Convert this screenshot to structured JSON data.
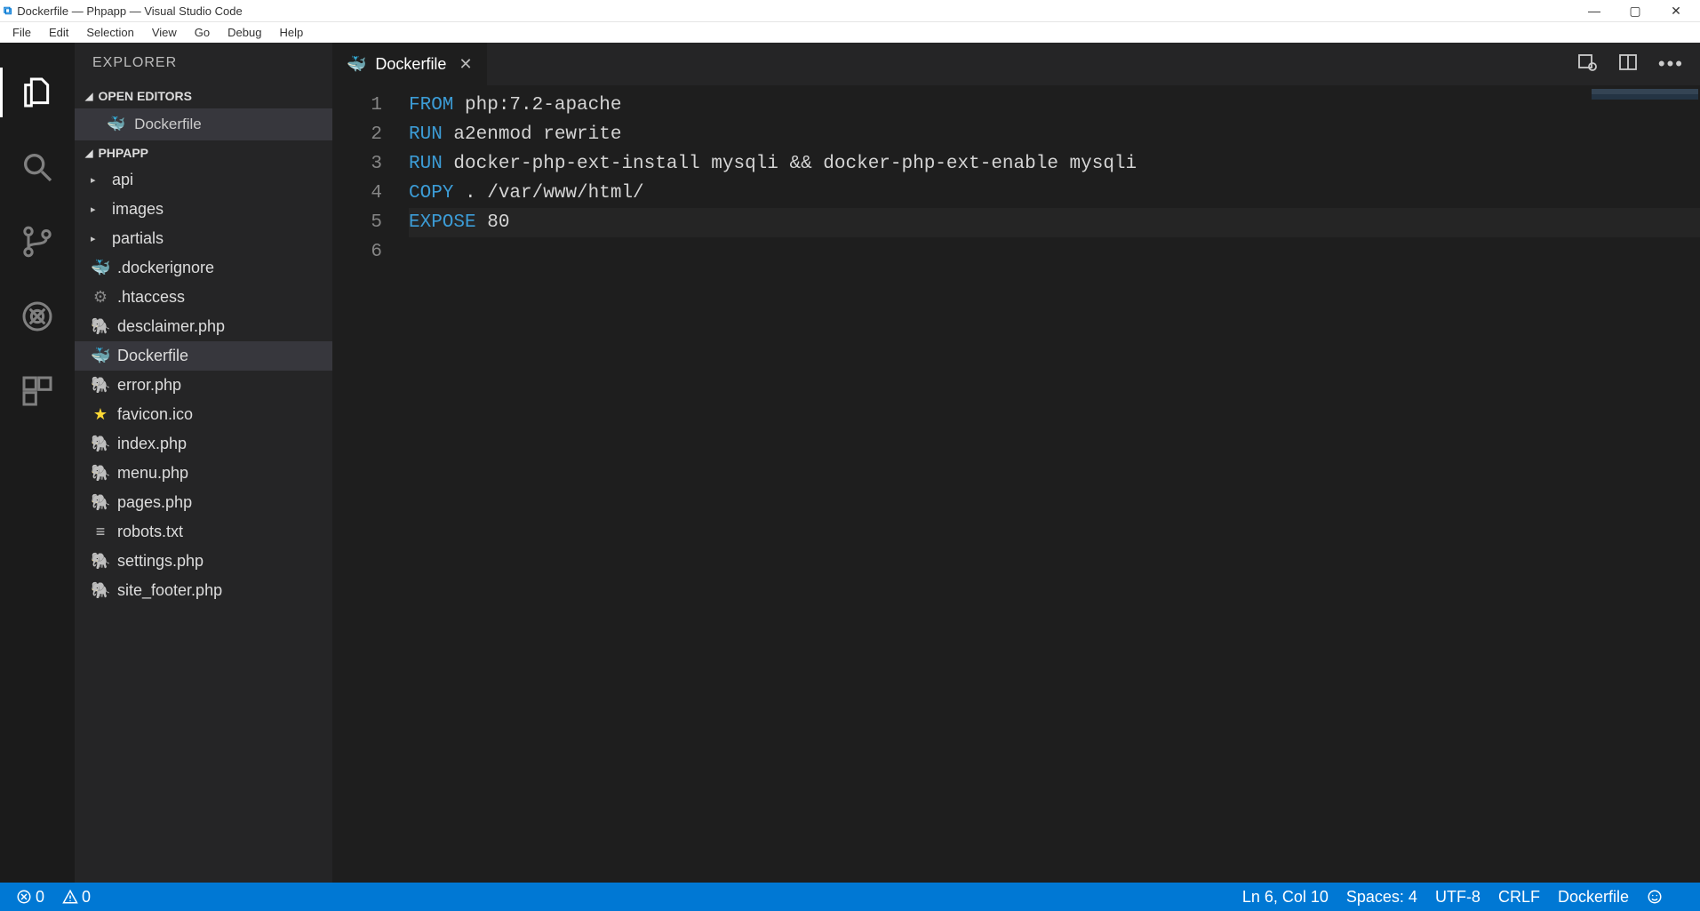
{
  "title_bar": {
    "title": "Dockerfile — Phpapp — Visual Studio Code"
  },
  "menu": {
    "items": [
      "File",
      "Edit",
      "Selection",
      "View",
      "Go",
      "Debug",
      "Help"
    ]
  },
  "sidebar": {
    "title": "EXPLORER",
    "open_editors_label": "OPEN EDITORS",
    "open_editor_file": "Dockerfile",
    "project_label": "PHPAPP",
    "tree": [
      {
        "name": "api",
        "type": "folder"
      },
      {
        "name": "images",
        "type": "folder"
      },
      {
        "name": "partials",
        "type": "folder"
      },
      {
        "name": ".dockerignore",
        "type": "file",
        "icon": "docker"
      },
      {
        "name": ".htaccess",
        "type": "file",
        "icon": "gear"
      },
      {
        "name": "desclaimer.php",
        "type": "file",
        "icon": "php"
      },
      {
        "name": "Dockerfile",
        "type": "file",
        "icon": "docker",
        "selected": true
      },
      {
        "name": "error.php",
        "type": "file",
        "icon": "php"
      },
      {
        "name": "favicon.ico",
        "type": "file",
        "icon": "star"
      },
      {
        "name": "index.php",
        "type": "file",
        "icon": "php"
      },
      {
        "name": "menu.php",
        "type": "file",
        "icon": "php"
      },
      {
        "name": "pages.php",
        "type": "file",
        "icon": "php"
      },
      {
        "name": "robots.txt",
        "type": "file",
        "icon": "lines"
      },
      {
        "name": "settings.php",
        "type": "file",
        "icon": "php"
      },
      {
        "name": "site_footer.php",
        "type": "file",
        "icon": "php"
      }
    ]
  },
  "tab": {
    "title": "Dockerfile"
  },
  "editor": {
    "lines": [
      {
        "n": "1",
        "segments": [
          [
            "kw-from",
            "FROM"
          ],
          [
            "txt",
            " php:7.2-apache"
          ]
        ]
      },
      {
        "n": "2",
        "segments": [
          [
            "kw-run",
            "RUN"
          ],
          [
            "txt",
            " a2enmod rewrite"
          ]
        ]
      },
      {
        "n": "3",
        "segments": [
          [
            "kw-run",
            "RUN"
          ],
          [
            "txt",
            " docker-php-ext-install mysqli && docker-php-ext-enable mysqli"
          ]
        ]
      },
      {
        "n": "4",
        "segments": [
          [
            "kw-copy",
            "COPY"
          ],
          [
            "txt",
            " . /var/www/html/"
          ]
        ]
      },
      {
        "n": "5",
        "segments": [
          [
            "txt",
            ""
          ]
        ]
      },
      {
        "n": "6",
        "segments": [
          [
            "kw-expose",
            "EXPOSE"
          ],
          [
            "txt",
            " 80"
          ]
        ],
        "current": true
      }
    ]
  },
  "status": {
    "errors": "0",
    "warnings": "0",
    "position": "Ln 6, Col 10",
    "spaces": "Spaces: 4",
    "encoding": "UTF-8",
    "eol": "CRLF",
    "language": "Dockerfile"
  }
}
